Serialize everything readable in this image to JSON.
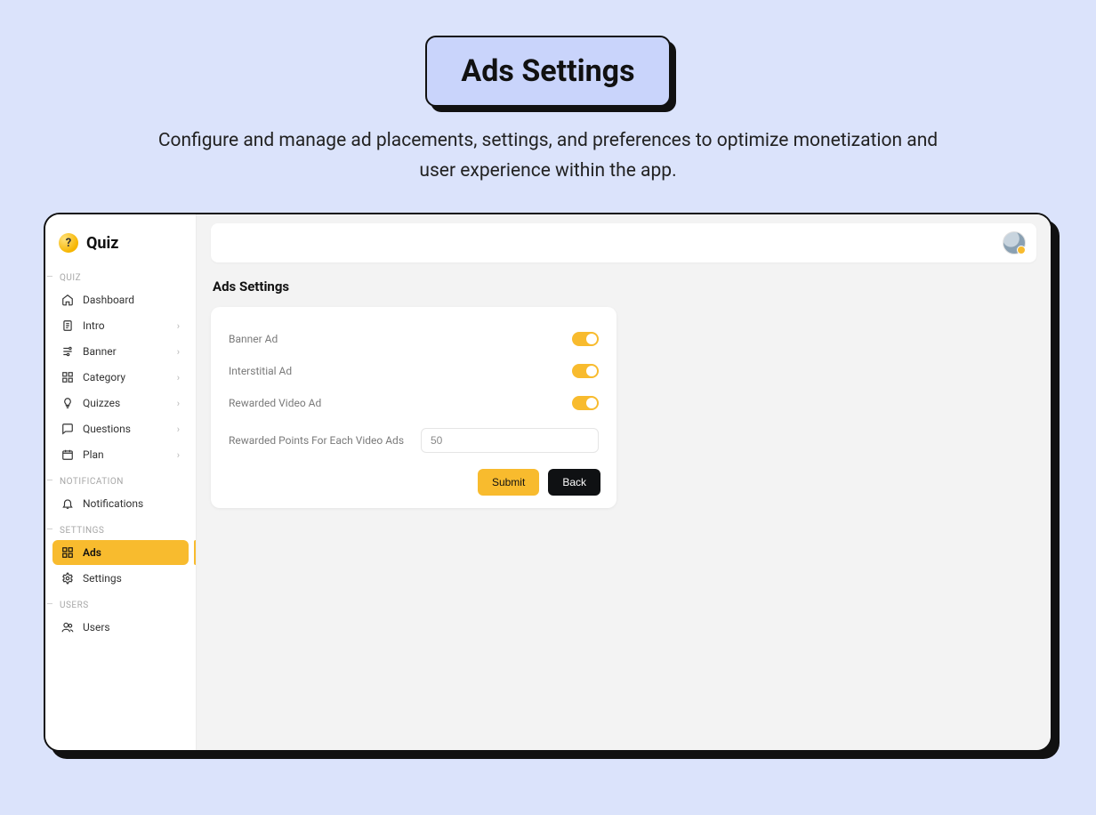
{
  "hero": {
    "title": "Ads Settings",
    "subtitle": "Configure and manage ad placements, settings, and preferences to optimize monetization and user experience within the app."
  },
  "brand": {
    "name": "Quiz",
    "mark": "?"
  },
  "sidebar": {
    "sections": [
      {
        "label": "QUIZ",
        "items": [
          {
            "label": "Dashboard",
            "icon": "home",
            "expandable": false
          },
          {
            "label": "Intro",
            "icon": "doc",
            "expandable": true
          },
          {
            "label": "Banner",
            "icon": "sliders",
            "expandable": true
          },
          {
            "label": "Category",
            "icon": "grid",
            "expandable": true
          },
          {
            "label": "Quizzes",
            "icon": "bulb",
            "expandable": true
          },
          {
            "label": "Questions",
            "icon": "chat",
            "expandable": true
          },
          {
            "label": "Plan",
            "icon": "calendar",
            "expandable": true
          }
        ]
      },
      {
        "label": "NOTIFICATION",
        "items": [
          {
            "label": "Notifications",
            "icon": "bell",
            "expandable": false
          }
        ]
      },
      {
        "label": "SETTINGS",
        "items": [
          {
            "label": "Ads",
            "icon": "grid",
            "expandable": false,
            "active": true
          },
          {
            "label": "Settings",
            "icon": "gear",
            "expandable": false
          }
        ]
      },
      {
        "label": "USERS",
        "items": [
          {
            "label": "Users",
            "icon": "users",
            "expandable": false
          }
        ]
      }
    ]
  },
  "page": {
    "title": "Ads Settings",
    "toggles": [
      {
        "label": "Banner Ad",
        "on": true
      },
      {
        "label": "Interstitial Ad",
        "on": true
      },
      {
        "label": "Rewarded Video Ad",
        "on": true
      }
    ],
    "points_label": "Rewarded Points For Each Video Ads",
    "points_value": "50",
    "submit": "Submit",
    "back": "Back"
  }
}
